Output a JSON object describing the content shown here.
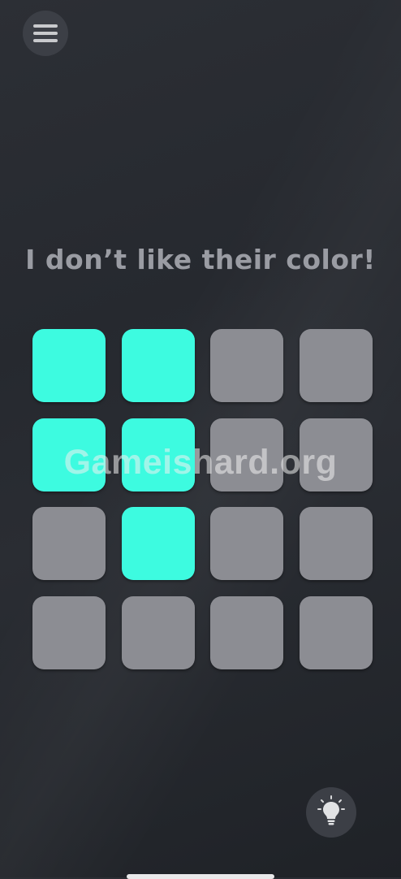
{
  "menu": {
    "icon": "hamburger-menu-icon"
  },
  "puzzle": {
    "prompt": "I don’t like their color!",
    "grid": {
      "rows": 4,
      "cols": 4,
      "lit_color": "#3dfbe0",
      "unlit_color": "#8c8d93",
      "state": [
        [
          true,
          true,
          false,
          false
        ],
        [
          true,
          true,
          false,
          false
        ],
        [
          false,
          true,
          false,
          false
        ],
        [
          false,
          false,
          false,
          false
        ]
      ]
    }
  },
  "watermark": {
    "text": "Gameishard.org"
  },
  "hint": {
    "icon": "lightbulb-icon"
  },
  "colors": {
    "background": "#26292f",
    "button_bg": "#3c3f46",
    "prompt_text": "#9a9ca3"
  }
}
